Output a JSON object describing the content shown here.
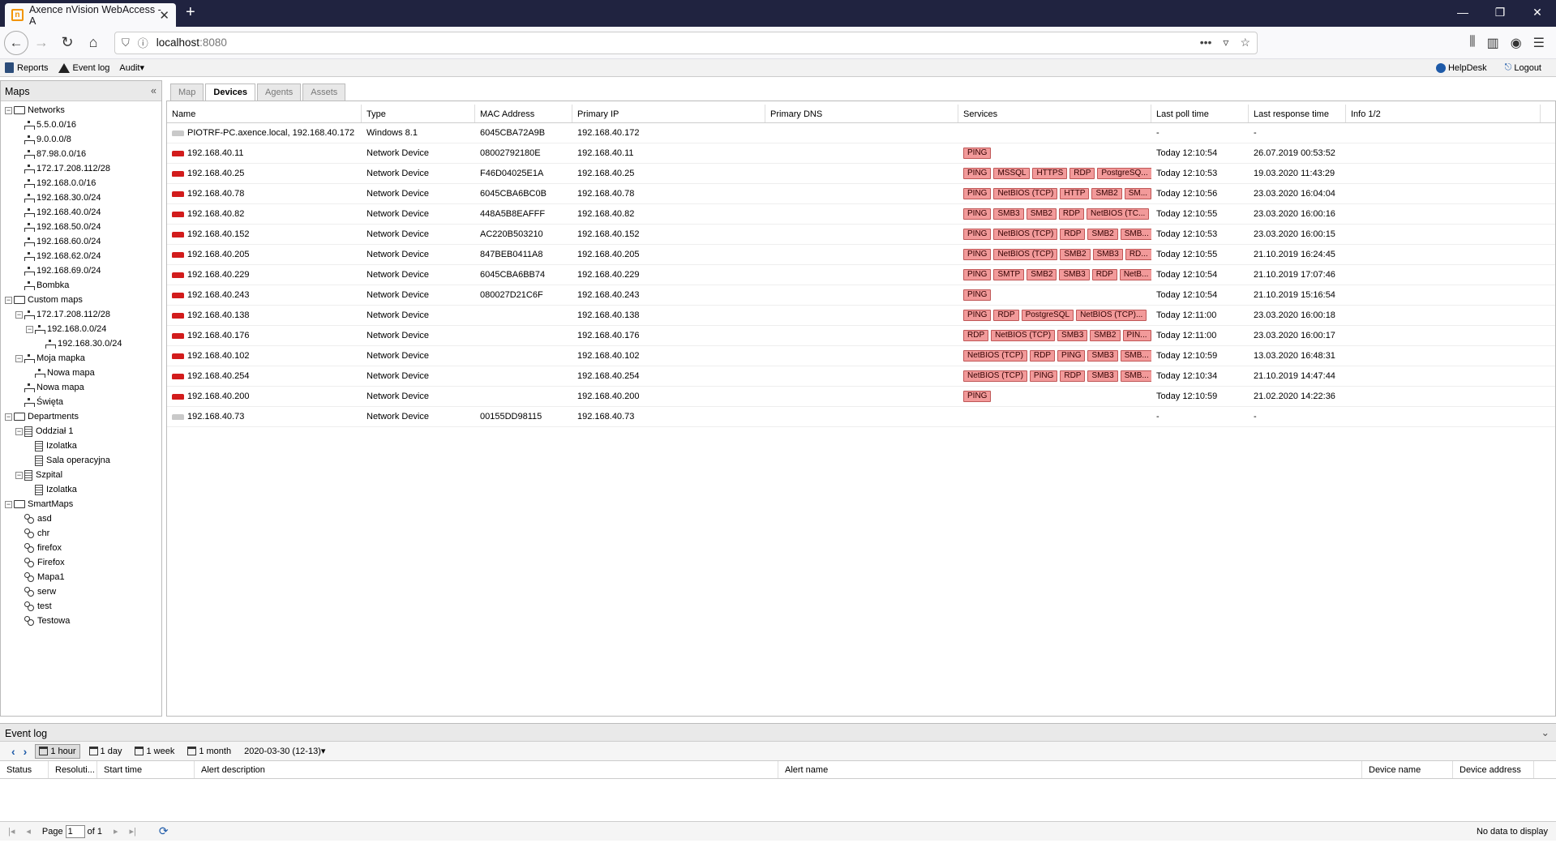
{
  "browser": {
    "tab_title": "Axence nVision WebAccess - A",
    "tab_favicon_letter": "n",
    "url_host": "localhost",
    "url_port": ":8080"
  },
  "toolbar": {
    "reports": "Reports",
    "event_log": "Event log",
    "audit": "Audit",
    "helpdesk": "HelpDesk",
    "logout": "Logout"
  },
  "maps": {
    "title": "Maps",
    "tree": [
      {
        "label": "Networks",
        "level": 0,
        "kind": "folder",
        "exp": "−"
      },
      {
        "label": "5.5.0.0/16",
        "level": 1,
        "kind": "net"
      },
      {
        "label": "9.0.0.0/8",
        "level": 1,
        "kind": "net"
      },
      {
        "label": "87.98.0.0/16",
        "level": 1,
        "kind": "net"
      },
      {
        "label": "172.17.208.112/28",
        "level": 1,
        "kind": "net"
      },
      {
        "label": "192.168.0.0/16",
        "level": 1,
        "kind": "net"
      },
      {
        "label": "192.168.30.0/24",
        "level": 1,
        "kind": "net"
      },
      {
        "label": "192.168.40.0/24",
        "level": 1,
        "kind": "net"
      },
      {
        "label": "192.168.50.0/24",
        "level": 1,
        "kind": "net"
      },
      {
        "label": "192.168.60.0/24",
        "level": 1,
        "kind": "net"
      },
      {
        "label": "192.168.62.0/24",
        "level": 1,
        "kind": "net"
      },
      {
        "label": "192.168.69.0/24",
        "level": 1,
        "kind": "net"
      },
      {
        "label": "Bombka",
        "level": 1,
        "kind": "net"
      },
      {
        "label": "Custom maps",
        "level": 0,
        "kind": "folder",
        "exp": "−"
      },
      {
        "label": "172.17.208.112/28",
        "level": 1,
        "kind": "net",
        "exp": "−"
      },
      {
        "label": "192.168.0.0/24",
        "level": 2,
        "kind": "net",
        "exp": "−"
      },
      {
        "label": "192.168.30.0/24",
        "level": 3,
        "kind": "net"
      },
      {
        "label": "Moja mapka",
        "level": 1,
        "kind": "net",
        "exp": "−"
      },
      {
        "label": "Nowa mapa",
        "level": 2,
        "kind": "net"
      },
      {
        "label": "Nowa mapa",
        "level": 1,
        "kind": "net"
      },
      {
        "label": "Święta",
        "level": 1,
        "kind": "net"
      },
      {
        "label": "Departments",
        "level": 0,
        "kind": "folder",
        "exp": "−"
      },
      {
        "label": "Oddział 1",
        "level": 1,
        "kind": "bld",
        "exp": "−"
      },
      {
        "label": "Izolatka",
        "level": 2,
        "kind": "bld"
      },
      {
        "label": "Sala operacyjna",
        "level": 2,
        "kind": "bld"
      },
      {
        "label": "Szpital",
        "level": 1,
        "kind": "bld",
        "exp": "−"
      },
      {
        "label": "Izolatka",
        "level": 2,
        "kind": "bld"
      },
      {
        "label": "SmartMaps",
        "level": 0,
        "kind": "folder",
        "exp": "−"
      },
      {
        "label": "asd",
        "level": 1,
        "kind": "smart"
      },
      {
        "label": "chr",
        "level": 1,
        "kind": "smart"
      },
      {
        "label": "firefox",
        "level": 1,
        "kind": "smart"
      },
      {
        "label": "Firefox",
        "level": 1,
        "kind": "smart"
      },
      {
        "label": "Mapa1",
        "level": 1,
        "kind": "smart"
      },
      {
        "label": "serw",
        "level": 1,
        "kind": "smart"
      },
      {
        "label": "test",
        "level": 1,
        "kind": "smart"
      },
      {
        "label": "Testowa",
        "level": 1,
        "kind": "smart"
      }
    ]
  },
  "tabs": [
    "Map",
    "Devices",
    "Agents",
    "Assets"
  ],
  "active_tab": "Devices",
  "devices": {
    "columns": [
      "Name",
      "Type",
      "MAC Address",
      "Primary IP",
      "Primary DNS",
      "Services",
      "Last poll time",
      "Last response time",
      "Info 1/2"
    ],
    "rows": [
      {
        "status": "gray",
        "name": "PIOTRF-PC.axence.local, 192.168.40.172",
        "type": "Windows 8.1",
        "mac": "6045CBA72A9B",
        "ip": "192.168.40.172",
        "dns": "",
        "services": [],
        "poll": "-",
        "resp": "-"
      },
      {
        "status": "red",
        "name": "192.168.40.11",
        "type": "Network Device",
        "mac": "08002792180E",
        "ip": "192.168.40.11",
        "dns": "",
        "services": [
          "PING"
        ],
        "poll": "Today 12:10:54",
        "resp": "26.07.2019 00:53:52"
      },
      {
        "status": "red",
        "name": "192.168.40.25",
        "type": "Network Device",
        "mac": "F46D04025E1A",
        "ip": "192.168.40.25",
        "dns": "",
        "services": [
          "PING",
          "MSSQL",
          "HTTPS",
          "RDP",
          "PostgreSQ..."
        ],
        "poll": "Today 12:10:53",
        "resp": "19.03.2020 11:43:29"
      },
      {
        "status": "red",
        "name": "192.168.40.78",
        "type": "Network Device",
        "mac": "6045CBA6BC0B",
        "ip": "192.168.40.78",
        "dns": "",
        "services": [
          "PING",
          "NetBIOS (TCP)",
          "HTTP",
          "SMB2",
          "SM..."
        ],
        "poll": "Today 12:10:56",
        "resp": "23.03.2020 16:04:04"
      },
      {
        "status": "red",
        "name": "192.168.40.82",
        "type": "Network Device",
        "mac": "448A5B8EAFFF",
        "ip": "192.168.40.82",
        "dns": "",
        "services": [
          "PING",
          "SMB3",
          "SMB2",
          "RDP",
          "NetBIOS (TC..."
        ],
        "poll": "Today 12:10:55",
        "resp": "23.03.2020 16:00:16"
      },
      {
        "status": "red",
        "name": "192.168.40.152",
        "type": "Network Device",
        "mac": "AC220B503210",
        "ip": "192.168.40.152",
        "dns": "",
        "services": [
          "PING",
          "NetBIOS (TCP)",
          "RDP",
          "SMB2",
          "SMB..."
        ],
        "poll": "Today 12:10:53",
        "resp": "23.03.2020 16:00:15"
      },
      {
        "status": "red",
        "name": "192.168.40.205",
        "type": "Network Device",
        "mac": "847BEB0411A8",
        "ip": "192.168.40.205",
        "dns": "",
        "services": [
          "PING",
          "NetBIOS (TCP)",
          "SMB2",
          "SMB3",
          "RD..."
        ],
        "poll": "Today 12:10:55",
        "resp": "21.10.2019 16:24:45"
      },
      {
        "status": "red",
        "name": "192.168.40.229",
        "type": "Network Device",
        "mac": "6045CBA6BB74",
        "ip": "192.168.40.229",
        "dns": "",
        "services": [
          "PING",
          "SMTP",
          "SMB2",
          "SMB3",
          "RDP",
          "NetB..."
        ],
        "poll": "Today 12:10:54",
        "resp": "21.10.2019 17:07:46"
      },
      {
        "status": "red",
        "name": "192.168.40.243",
        "type": "Network Device",
        "mac": "080027D21C6F",
        "ip": "192.168.40.243",
        "dns": "",
        "services": [
          "PING"
        ],
        "poll": "Today 12:10:54",
        "resp": "21.10.2019 15:16:54"
      },
      {
        "status": "red",
        "name": "192.168.40.138",
        "type": "Network Device",
        "mac": "",
        "ip": "192.168.40.138",
        "dns": "",
        "services": [
          "PING",
          "RDP",
          "PostgreSQL",
          "NetBIOS (TCP)..."
        ],
        "poll": "Today 12:11:00",
        "resp": "23.03.2020 16:00:18"
      },
      {
        "status": "red",
        "name": "192.168.40.176",
        "type": "Network Device",
        "mac": "",
        "ip": "192.168.40.176",
        "dns": "",
        "services": [
          "RDP",
          "NetBIOS (TCP)",
          "SMB3",
          "SMB2",
          "PIN..."
        ],
        "poll": "Today 12:11:00",
        "resp": "23.03.2020 16:00:17"
      },
      {
        "status": "red",
        "name": "192.168.40.102",
        "type": "Network Device",
        "mac": "",
        "ip": "192.168.40.102",
        "dns": "",
        "services": [
          "NetBIOS (TCP)",
          "RDP",
          "PING",
          "SMB3",
          "SMB..."
        ],
        "poll": "Today 12:10:59",
        "resp": "13.03.2020 16:48:31"
      },
      {
        "status": "red",
        "name": "192.168.40.254",
        "type": "Network Device",
        "mac": "",
        "ip": "192.168.40.254",
        "dns": "",
        "services": [
          "NetBIOS (TCP)",
          "PING",
          "RDP",
          "SMB3",
          "SMB..."
        ],
        "poll": "Today 12:10:34",
        "resp": "21.10.2019 14:47:44"
      },
      {
        "status": "red",
        "name": "192.168.40.200",
        "type": "Network Device",
        "mac": "",
        "ip": "192.168.40.200",
        "dns": "",
        "services": [
          "PING"
        ],
        "poll": "Today 12:10:59",
        "resp": "21.02.2020 14:22:36"
      },
      {
        "status": "gray",
        "name": "192.168.40.73",
        "type": "Network Device",
        "mac": "00155DD98115",
        "ip": "192.168.40.73",
        "dns": "",
        "services": [],
        "poll": "-",
        "resp": "-"
      }
    ]
  },
  "event_log": {
    "title": "Event log",
    "ranges": [
      "1 hour",
      "1 day",
      "1 week",
      "1 month"
    ],
    "selected_range": "1 hour",
    "date": "2020-03-30 (12-13)",
    "columns": [
      "Status",
      "Resoluti...",
      "Start time",
      "Alert description",
      "Alert name",
      "Device name",
      "Device address"
    ],
    "page_label": "Page",
    "page_value": "1",
    "of_label": "of 1",
    "no_data": "No data to display"
  },
  "colors": {
    "titlebar": "#202340",
    "service_badge": "#f29a9a",
    "device_down": "#d21c1c"
  }
}
